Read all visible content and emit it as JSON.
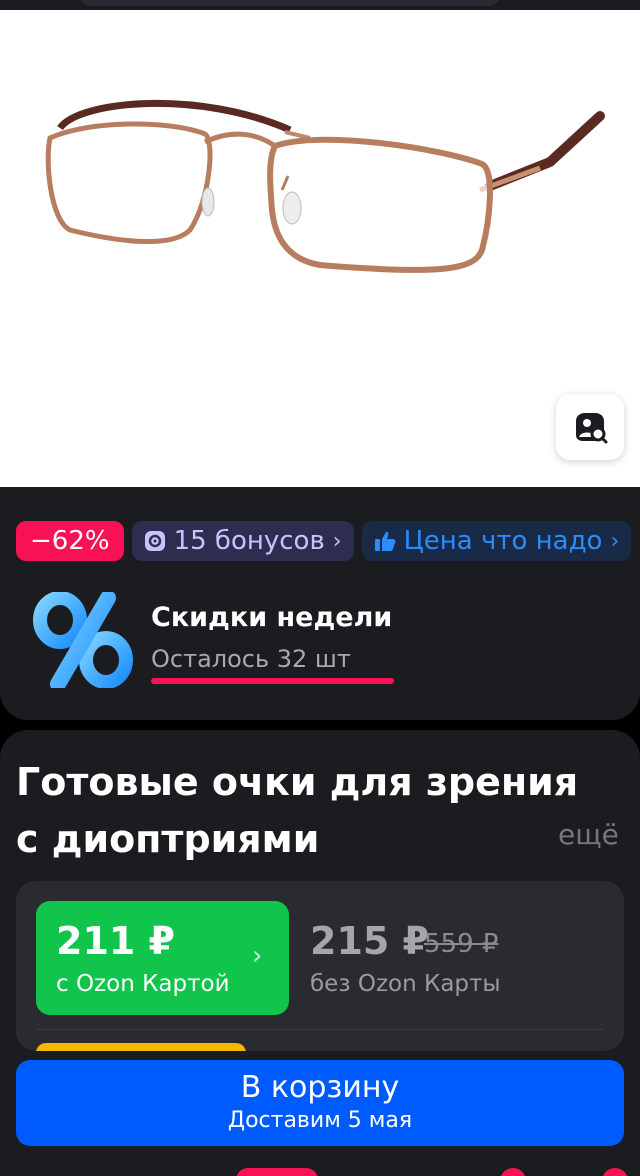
{
  "colors": {
    "background": "#1b1c20",
    "discount_pink": "#f91155",
    "ozon_green": "#10c44c",
    "ozon_blue": "#005bff",
    "bonus_purple": "#2f2d4f"
  },
  "product_image": {
    "icon": "eyeglasses-photo",
    "visual_search_icon": "camera-search-icon"
  },
  "badges": {
    "discount": "−62%",
    "bonus": "15 бонусов",
    "bonus_icon": "bonus-coin-icon",
    "price_tag": "Цена что надо",
    "price_tag_icon": "thumbs-up-icon"
  },
  "promo": {
    "icon": "percent-icon",
    "title": "Скидки недели",
    "remaining": "Осталось 32 шт"
  },
  "product": {
    "title": "Готовые очки для зрения с диоптриями",
    "more_link": "ещё"
  },
  "pricing": {
    "card_price": "211 ₽",
    "card_label": "с Ozon Картой",
    "regular_price": "215 ₽",
    "old_price": "559 ₽",
    "regular_label": "без Ozon Карты"
  },
  "cart": {
    "button_label": "В корзину",
    "delivery": "Доставим 5 мая"
  }
}
